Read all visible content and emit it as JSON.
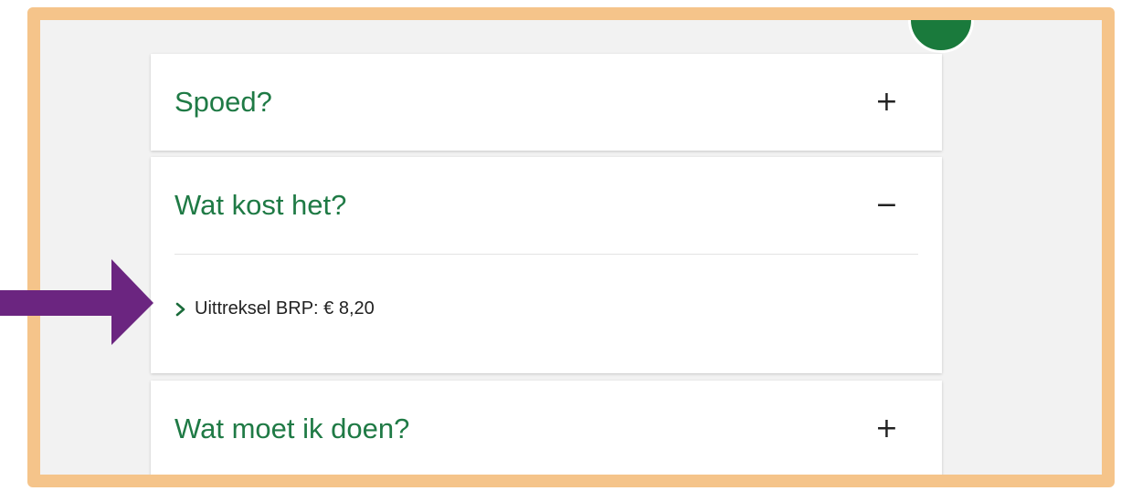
{
  "accordion": {
    "items": [
      {
        "title": "Spoed?",
        "toggle": "+",
        "expanded": false
      },
      {
        "title": "Wat kost het?",
        "toggle": "−",
        "expanded": true,
        "content": [
          "Uittreksel BRP: € 8,20"
        ]
      },
      {
        "title": "Wat moet ik doen?",
        "toggle": "+",
        "expanded": false
      }
    ]
  },
  "colors": {
    "frame_border": "#f5c48a",
    "heading_green": "#1f7a45",
    "arrow_purple": "#6b2580",
    "circle_green": "#1a7a3c"
  },
  "icons": [
    "chevron-right-icon",
    "plus-icon",
    "minus-icon",
    "arrow-right-icon"
  ]
}
